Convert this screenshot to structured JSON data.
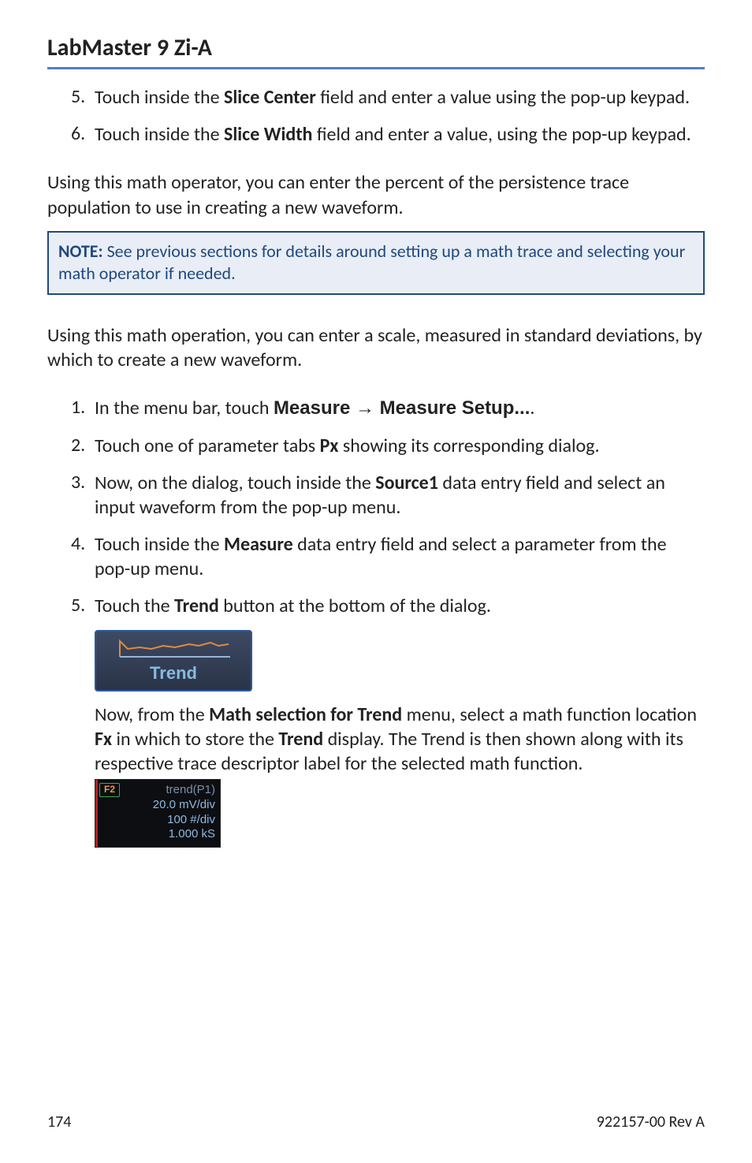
{
  "header": {
    "title": "LabMaster 9 Zi-A"
  },
  "list1": {
    "items": [
      {
        "num": "5.",
        "pre": "Touch inside the ",
        "bold": "Slice Center",
        "post": " field and enter a value using the pop-up keypad."
      },
      {
        "num": "6.",
        "pre": "Touch inside the ",
        "bold": "Slice Width",
        "post": " field and enter a value, using the pop-up keypad."
      }
    ]
  },
  "para1": "Using this math operator, you can enter the percent of the persistence trace population to use in creating a new waveform.",
  "note": {
    "label": "NOTE:",
    "text": " See previous sections for details around setting up a math trace and selecting your math operator if needed."
  },
  "para2": "Using this math operation, you can enter a scale, measured in standard deviations, by which to create a new waveform.",
  "list2": {
    "items": [
      {
        "num": "1.",
        "pre": "In the menu bar, touch ",
        "bold": "Measure → Measure Setup...",
        "post": "."
      },
      {
        "num": "2.",
        "pre": "Touch one of parameter tabs ",
        "bold": "Px",
        "post": " showing its corresponding dialog."
      },
      {
        "num": "3.",
        "pre": "Now, on the dialog, touch inside the ",
        "bold": "Source1",
        "post": " data entry field and select an input waveform from the pop-up menu."
      },
      {
        "num": "4.",
        "pre": "Touch inside the ",
        "bold": "Measure",
        "post": " data entry field and select a parameter from the pop-up menu."
      },
      {
        "num": "5.",
        "pre": "Touch the ",
        "bold": "Trend",
        "post": " button at the bottom of the dialog."
      }
    ]
  },
  "trend_button": {
    "label": "Trend"
  },
  "after_trend": {
    "seg1": "Now, from the ",
    "b1": "Math selection for Trend",
    "seg2": " menu, select a math function location ",
    "b2": "Fx",
    "seg3": " in which to store the ",
    "b3": "Trend",
    "seg4": " display. The Trend is then shown along with its respective trace descriptor label for the selected math function."
  },
  "descriptor": {
    "badge": "F2",
    "line1": "trend(P1)",
    "line2": "20.0 mV/div",
    "line3": "100 #/div",
    "line4": "1.000 kS"
  },
  "footer": {
    "page_num": "174",
    "doc_id": "922157-00 Rev A"
  }
}
